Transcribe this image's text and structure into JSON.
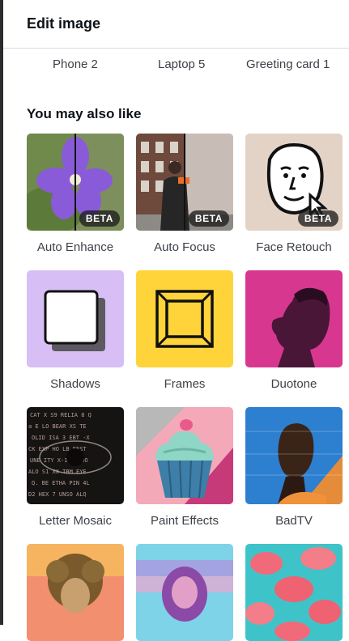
{
  "header": {
    "title": "Edit image"
  },
  "mockups": [
    "Phone 2",
    "Laptop 5",
    "Greeting card 1"
  ],
  "section": {
    "title": "You may also like"
  },
  "tiles": [
    {
      "label": "Auto Enhance",
      "badge": "BETA",
      "icon": "flower-photo"
    },
    {
      "label": "Auto Focus",
      "badge": "BETA",
      "icon": "street-person-photo"
    },
    {
      "label": "Face Retouch",
      "badge": "BETA",
      "icon": "face-outline-icon"
    },
    {
      "label": "Shadows",
      "icon": "shadow-square-icon"
    },
    {
      "label": "Frames",
      "icon": "frame-square-icon"
    },
    {
      "label": "Duotone",
      "icon": "duotone-portrait-photo"
    },
    {
      "label": "Letter Mosaic",
      "icon": "letter-mosaic-eye-photo"
    },
    {
      "label": "Paint Effects",
      "icon": "cupcake-photo"
    },
    {
      "label": "BadTV",
      "icon": "glitch-portrait-photo"
    },
    {
      "label": "",
      "icon": "curly-hair-portrait-photo"
    },
    {
      "label": "",
      "icon": "rainbow-portrait-photo"
    },
    {
      "label": "",
      "icon": "pink-pattern-photo"
    }
  ],
  "colors": {
    "text": "#0e1318",
    "muted": "#3d4148",
    "divider": "#d9dce1",
    "shadowsBg": "#d7bff5",
    "framesBg": "#ffd43a",
    "faceBg": "#e3d3c6",
    "duotonePink": "#d8378f"
  }
}
